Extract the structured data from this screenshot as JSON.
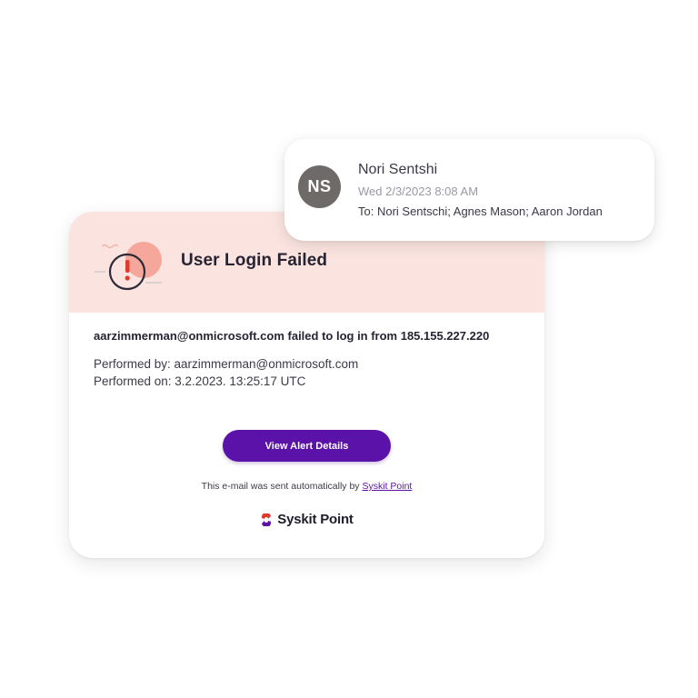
{
  "alert": {
    "title": "User Login Failed",
    "message": "aarzimmerman@onmicrosoft.com failed to log in from 185.155.227.220",
    "performed_by": "Performed by: aarzimmerman@onmicrosoft.com",
    "performed_on": "Performed on: 3.2.2023. 13:25:17 UTC",
    "button_label": "View Alert Details",
    "footer_text": "This e-mail was sent automatically by ",
    "footer_link": "Syskit Point",
    "brand_name": "Syskit Point",
    "icon": "warning-icon"
  },
  "sender": {
    "initials": "NS",
    "name": "Nori Sentshi",
    "date": "Wed 2/3/2023 8:08 AM",
    "recipients": "To: Nori Sentschi; Agnes Mason; Aaron Jordan"
  },
  "colors": {
    "header_bg": "#fbe4e0",
    "accent": "#5a12a8",
    "avatar_bg": "#6e6a68",
    "alert_red": "#e03a2f"
  }
}
